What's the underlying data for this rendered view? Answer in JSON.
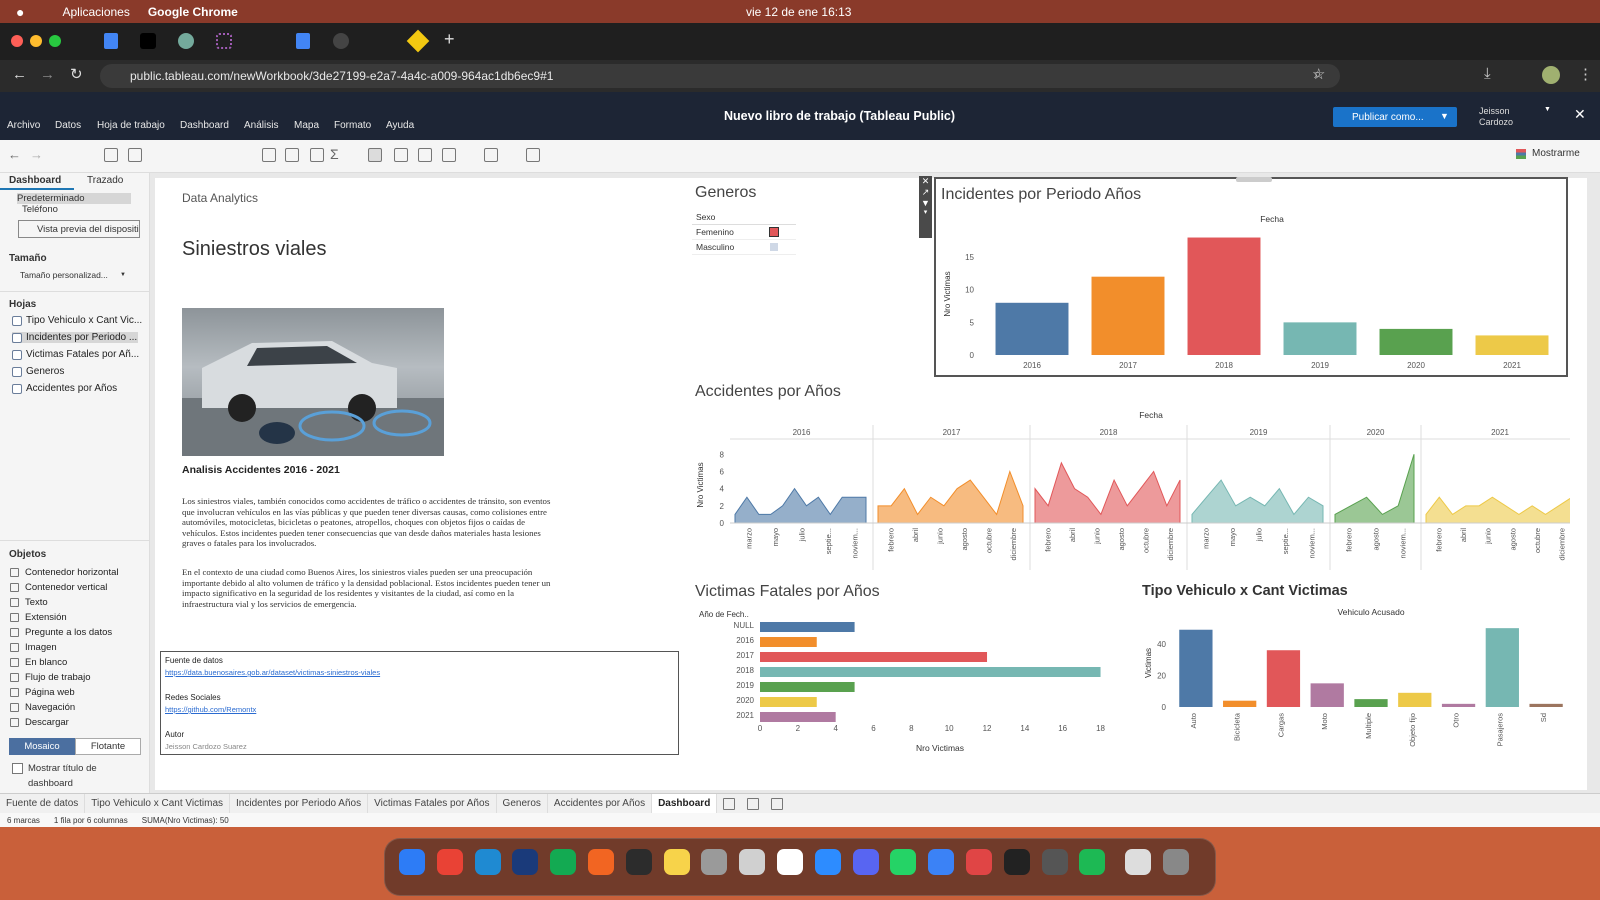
{
  "mac": {
    "apps": "Aplicaciones",
    "app": "Google Chrome",
    "datetime": "vie 12 de ene  16:13"
  },
  "chrome": {
    "url": "public.tableau.com/newWorkbook/3de27199-e2a7-4a4c-a009-964ac1db6ec9#1"
  },
  "tableau": {
    "menu": [
      "Archivo",
      "Datos",
      "Hoja de trabajo",
      "Dashboard",
      "Análisis",
      "Mapa",
      "Formato",
      "Ayuda"
    ],
    "title": "Nuevo libro de trabajo (Tableau Public)",
    "publish": "Publicar como...",
    "user": "Jeisson Cardozo",
    "showme": "Mostrarme"
  },
  "left": {
    "tab_dashboard": "Dashboard",
    "tab_layout": "Trazado",
    "device_default": "Predeterminado",
    "device_phone": "Teléfono",
    "preview": "Vista previa del dispositi",
    "size_label": "Tamaño",
    "size_value": "Tamaño personalizad...",
    "sheets_label": "Hojas",
    "sheets": [
      "Tipo Vehiculo x Cant Vic...",
      "Incidentes por Periodo ...",
      "Victimas Fatales por Añ...",
      "Generos",
      "Accidentes por Años"
    ],
    "objects_label": "Objetos",
    "objects": [
      "Contenedor horizontal",
      "Contenedor vertical",
      "Texto",
      "Extensión",
      "Pregunte a los datos",
      "Imagen",
      "En blanco",
      "Flujo de trabajo",
      "Página web",
      "Navegación",
      "Descargar"
    ],
    "tiled": "Mosaico",
    "floating": "Flotante",
    "show_title": "Mostrar título de dashboard"
  },
  "dashboard": {
    "kicker": "Data Analytics",
    "title": "Siniestros viales",
    "caption": "Analisis Accidentes 2016 - 2021",
    "para1": "Los siniestros viales, también conocidos como accidentes de tráfico o accidentes de tránsito, son eventos que involucran vehículos en las vías públicas y que pueden tener diversas causas, como colisiones entre automóviles, motocicletas, bicicletas o peatones, atropellos, choques con objetos fijos o caídas de vehículos. Estos incidentes pueden tener consecuencias que van desde daños materiales hasta lesiones graves o fatales para los involucrados.",
    "para2": "En el contexto de una ciudad como Buenos Aires, los siniestros viales pueden ser una preocupación importante debido al alto volumen de tráfico y la densidad poblacional. Estos incidentes pueden tener un impacto significativo en la seguridad de los residentes y visitantes de la ciudad, así como en la infraestructura vial y los servicios de emergencia.",
    "src_label": "Fuente de datos",
    "src_link": "https://data.buenosaires.gob.ar/dataset/victimas-siniestros-viales",
    "social_label": "Redes Sociales",
    "social_link": "https://github.com/Remontx",
    "author_label": "Autor",
    "author": "Jeisson Cardozo Suarez"
  },
  "generos": {
    "title": "Generos",
    "header": "Sexo",
    "items": [
      {
        "label": "Femenino",
        "color": "#e15759"
      },
      {
        "label": "Masculino",
        "color": "#cfd8e6"
      }
    ]
  },
  "chart_data": [
    {
      "id": "incidentes",
      "type": "bar",
      "title": "Incidentes por Periodo Años",
      "xlabel": "Fecha",
      "ylabel": "Nro Victimas",
      "categories": [
        "2016",
        "2017",
        "2018",
        "2019",
        "2020",
        "2021"
      ],
      "values": [
        8,
        12,
        18,
        5,
        4,
        3
      ],
      "colors": [
        "#4e79a7",
        "#f28e2b",
        "#e15759",
        "#76b7b2",
        "#59a14f",
        "#edc948"
      ],
      "yticks": [
        0,
        5,
        10,
        15
      ],
      "ylim": [
        0,
        19
      ]
    },
    {
      "id": "accidentes",
      "type": "area",
      "title": "Accidentes por Años",
      "xlabel": "Fecha",
      "ylabel": "Nro Victimas",
      "yticks": [
        0,
        2,
        4,
        6,
        8
      ],
      "ylim": [
        0,
        8.5
      ],
      "panels": [
        {
          "year": "2016",
          "color": "#4e79a7",
          "labels": [
            "marzo",
            "mayo",
            "julio",
            "septie...",
            "noviem..."
          ],
          "values": [
            1,
            3,
            1,
            1,
            2,
            4,
            2,
            3,
            1,
            3,
            3,
            3
          ]
        },
        {
          "year": "2017",
          "color": "#f28e2b",
          "labels": [
            "febrero",
            "abril",
            "junio",
            "agosto",
            "octubre",
            "diciembre"
          ],
          "values": [
            2,
            2,
            4,
            1,
            3,
            2,
            4,
            5,
            3,
            1,
            6,
            2
          ]
        },
        {
          "year": "2018",
          "color": "#e15759",
          "labels": [
            "febrero",
            "abril",
            "junio",
            "agosto",
            "octubre",
            "diciembre"
          ],
          "values": [
            4,
            2,
            7,
            4,
            3,
            1,
            5,
            2,
            4,
            6,
            2,
            5
          ]
        },
        {
          "year": "2019",
          "color": "#76b7b2",
          "labels": [
            "marzo",
            "mayo",
            "julio",
            "septie...",
            "noviem..."
          ],
          "values": [
            1,
            3,
            5,
            2,
            3,
            2,
            4,
            1,
            3,
            2
          ]
        },
        {
          "year": "2020",
          "color": "#59a14f",
          "labels": [
            "febrero",
            "agosto",
            "noviem..."
          ],
          "values": [
            1,
            2,
            3,
            1,
            2,
            8
          ]
        },
        {
          "year": "2021",
          "color": "#edc948",
          "labels": [
            "febrero",
            "abril",
            "junio",
            "agosto",
            "octubre",
            "diciembre"
          ],
          "values": [
            1,
            3,
            1,
            2,
            2,
            3,
            2,
            1,
            2,
            1,
            2,
            3
          ]
        }
      ]
    },
    {
      "id": "victimas",
      "type": "bar",
      "orientation": "horizontal",
      "title": "Victimas Fatales por Años",
      "ylabel": "Año de Fech..",
      "xlabel": "Nro Victimas",
      "categories": [
        "NULL",
        "2016",
        "2017",
        "2018",
        "2019",
        "2020",
        "2021"
      ],
      "values": [
        5,
        3,
        12,
        18,
        5,
        3,
        4
      ],
      "colors": [
        "#4e79a7",
        "#f28e2b",
        "#e15759",
        "#76b7b2",
        "#59a14f",
        "#edc948",
        "#b07aa1"
      ],
      "xticks": [
        0,
        2,
        4,
        6,
        8,
        10,
        12,
        14,
        16,
        18
      ],
      "xlim": [
        0,
        18.5
      ]
    },
    {
      "id": "tipo",
      "type": "bar",
      "title": "Tipo Vehiculo x Cant Victimas",
      "xlabel": "Vehiculo Acusado",
      "ylabel": "Victimas",
      "categories": [
        "Auto",
        "Bicicleta",
        "Cargas",
        "Moto",
        "Multiple",
        "Objeto fijo",
        "Otro",
        "Pasajeros",
        "Sd"
      ],
      "values": [
        49,
        4,
        36,
        15,
        5,
        9,
        2,
        50,
        2
      ],
      "colors": [
        "#4e79a7",
        "#f28e2b",
        "#e15759",
        "#b07aa1",
        "#59a14f",
        "#edc948",
        "#b07aa1",
        "#76b7b2",
        "#9c755f"
      ],
      "yticks": [
        0,
        20,
        40
      ],
      "ylim": [
        0,
        52
      ]
    }
  ],
  "tabs": [
    "Fuente de datos",
    "Tipo Vehiculo x Cant Victimas",
    "Incidentes por Periodo Años",
    "Victimas Fatales por Años",
    "Generos",
    "Accidentes por Años",
    "Dashboard"
  ],
  "status": {
    "marks": "6 marcas",
    "rows": "1 fila por 6 columnas",
    "sum": "SUMA(Nro Victimas): 50"
  }
}
